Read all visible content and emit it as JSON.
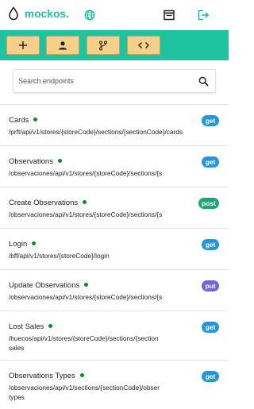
{
  "app": {
    "name": "mockos.",
    "brand_color": "#1fc0a0",
    "toolbar_color": "#20c3a0",
    "button_color": "#f6d08a"
  },
  "header": {
    "icons": [
      "drop-logo-icon",
      "globe-icon",
      "browser-window-icon",
      "logout-icon"
    ]
  },
  "toolbar": {
    "buttons": [
      {
        "icon": "plus-icon"
      },
      {
        "icon": "user-icon"
      },
      {
        "icon": "git-branch-icon"
      },
      {
        "icon": "code-icon"
      }
    ]
  },
  "search": {
    "placeholder": "Search endpoints",
    "value": "",
    "icon": "search-icon"
  },
  "endpoints": [
    {
      "name": "Cards",
      "path": "/prft/api/v1/stores/{storeCode}/sections/{sectionCode}/cards",
      "path_cont": "",
      "method": "get",
      "active": true
    },
    {
      "name": "Observations",
      "path": "/observaciones/api/v1/stores/{storeCode}/sections/{s",
      "path_cont": "",
      "method": "get",
      "active": true
    },
    {
      "name": "Create Observations",
      "path": "/observaciones/api/v1/stores/{storeCode}/sections/{s",
      "path_cont": "",
      "method": "post",
      "active": true
    },
    {
      "name": "Login",
      "path": "/bff/api/v1/stores/{storeCode}/login",
      "path_cont": "",
      "method": "get",
      "active": true
    },
    {
      "name": "Update Observations",
      "path": "/observaciones/api/v1/stores/{storeCode}/sections/{s",
      "path_cont": "",
      "method": "put",
      "active": true
    },
    {
      "name": "Lost Sales",
      "path": "/huecos/api/v1/stores/{storeCode}/sections/{section",
      "path_cont": "sales",
      "method": "get",
      "active": true
    },
    {
      "name": "Observations Types",
      "path": "/observaciones/api/v1/sections/{sectionCode}/obser",
      "path_cont": "types",
      "method": "get",
      "active": true
    }
  ]
}
